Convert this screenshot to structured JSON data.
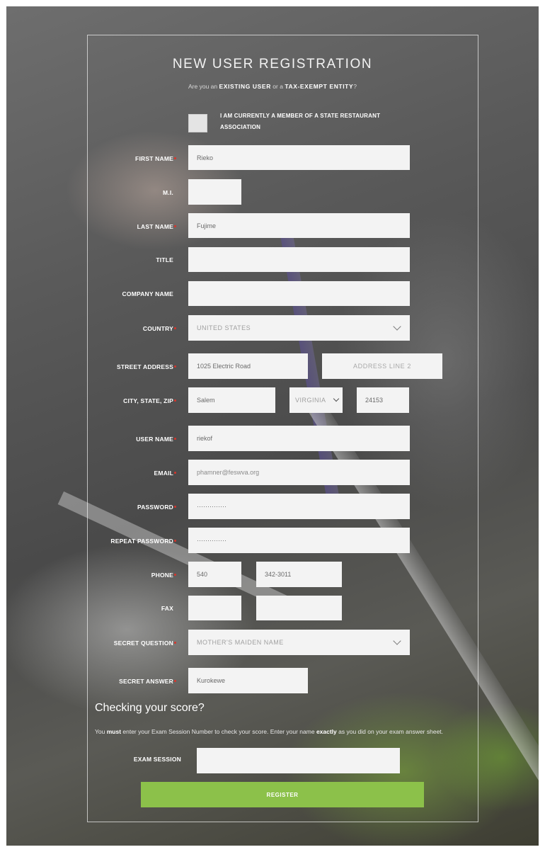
{
  "form": {
    "title": "NEW USER REGISTRATION",
    "subtitle_prefix": "Are you an ",
    "subtitle_existing": "EXISTING USER",
    "subtitle_mid": " or a ",
    "subtitle_tax": "TAX-EXEMPT ENTITY",
    "subtitle_suffix": "?",
    "member_line1": "I AM CURRENTLY A MEMBER OF A STATE RESTAURANT",
    "member_line2": "ASSOCIATION",
    "labels": {
      "first_name": "FIRST NAME",
      "mi": "M.I.",
      "last_name": "LAST NAME",
      "title": "TITLE",
      "company_name": "COMPANY NAME",
      "country": "COUNTRY",
      "street_address": "STREET ADDRESS",
      "city_state_zip": "CITY, STATE, ZIP",
      "user_name": "USER NAME",
      "email": "EMAIL",
      "password": "PASSWORD",
      "repeat_password": "REPEAT PASSWORD",
      "phone": "PHONE",
      "fax": "FAX",
      "secret_question": "SECRET QUESTION",
      "secret_answer": "SECRET ANSWER",
      "exam_session": "EXAM SESSION"
    },
    "values": {
      "first_name": "Rieko",
      "mi": "",
      "last_name": "Fujime",
      "title": "",
      "company_name": "",
      "country": "UNITED STATES",
      "street_address": "1025 Electric Road",
      "address_line2_placeholder": "ADDRESS LINE 2",
      "city": "Salem",
      "state": "VIRGINIA",
      "zip": "24153",
      "user_name": "riekof",
      "email": "phamner@feswva.org",
      "password": "··············",
      "repeat_password": "··············",
      "phone_area": "540",
      "phone_number": "342-3011",
      "fax_area": "",
      "fax_number": "",
      "secret_question": "MOTHER'S MAIDEN NAME",
      "secret_answer": "Kurokewe",
      "exam_session": ""
    }
  },
  "score": {
    "heading": "Checking your score?",
    "text_1": "You ",
    "text_must": "must",
    "text_2": " enter your Exam Session Number to check your score. Enter your name ",
    "text_exactly": "exactly",
    "text_3": " as you did on your exam answer sheet."
  },
  "register_label": "REGISTER",
  "colors": {
    "accent_green": "#8cc14a",
    "required_red": "#d9342b",
    "field_bg": "#f3f3f3"
  },
  "icons": {
    "dropdown": "chevron-down-icon",
    "required": "required-dot-icon"
  }
}
